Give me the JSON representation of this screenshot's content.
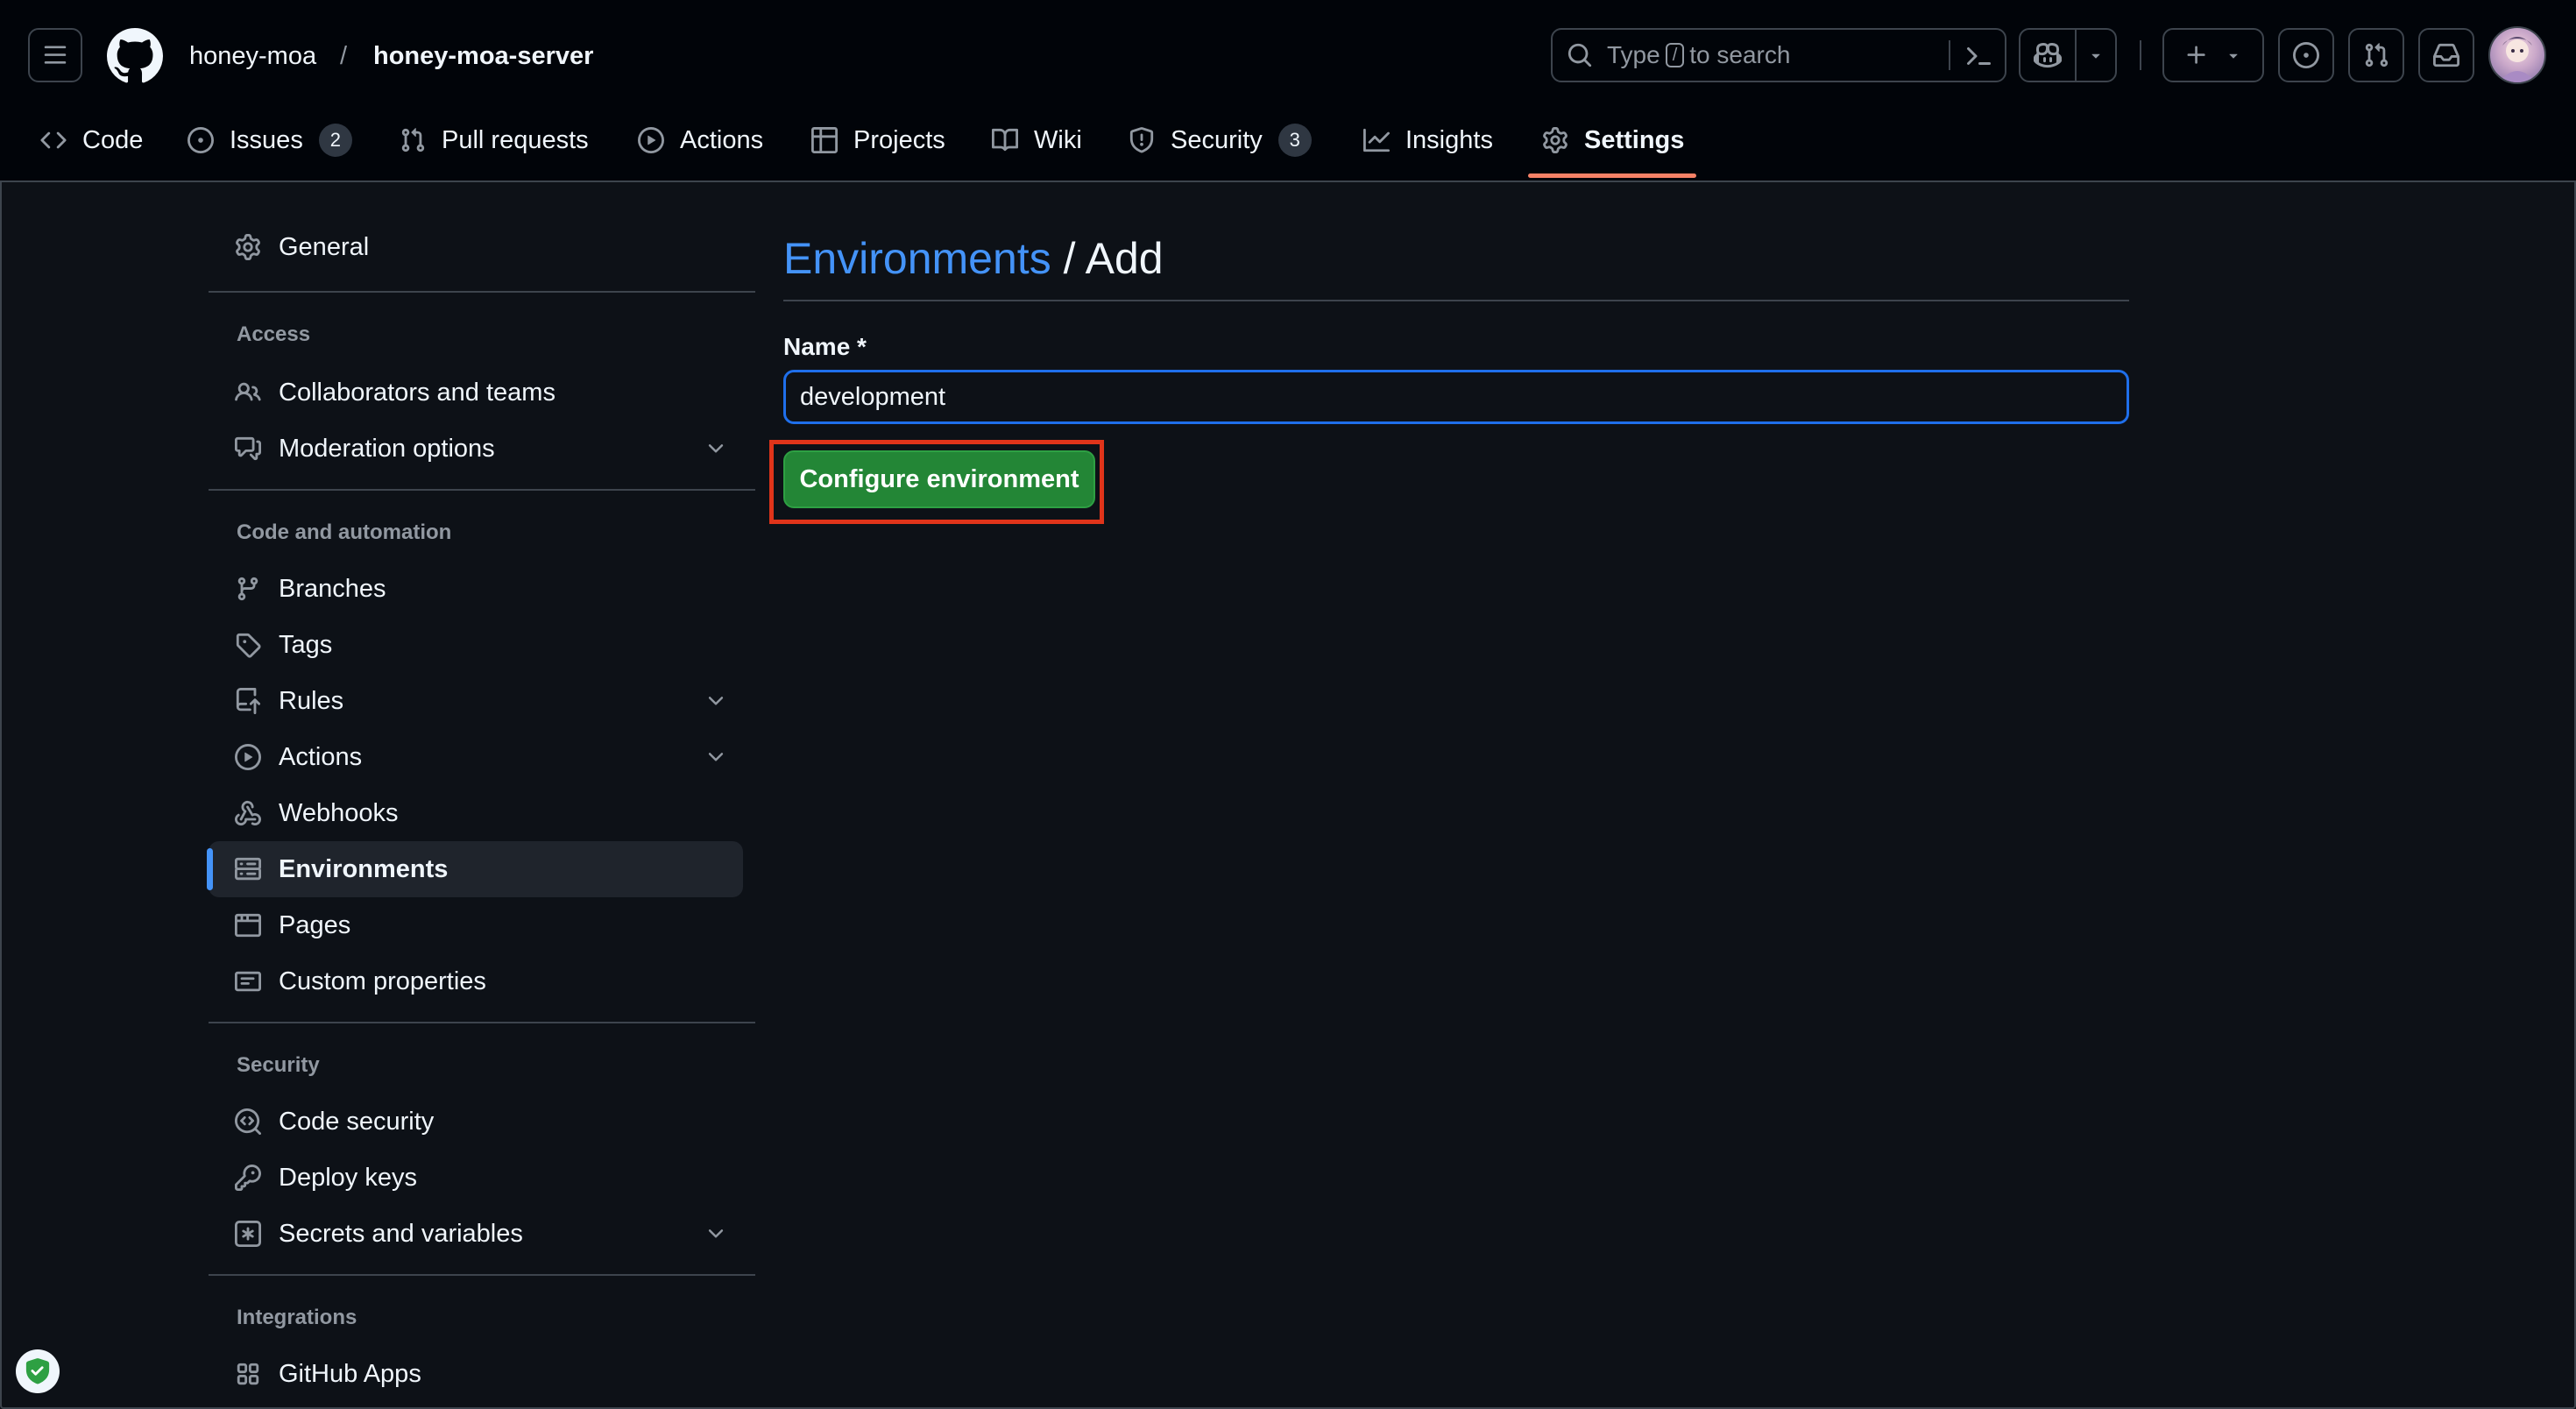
{
  "header": {
    "owner": "honey-moa",
    "separator": "/",
    "repo": "honey-moa-server",
    "search": {
      "prefix": "Type",
      "key": "/",
      "suffix": "to search"
    }
  },
  "tabs": [
    {
      "label": "Code",
      "icon": "code-icon"
    },
    {
      "label": "Issues",
      "icon": "issue-icon",
      "count": "2"
    },
    {
      "label": "Pull requests",
      "icon": "pull-request-icon"
    },
    {
      "label": "Actions",
      "icon": "play-icon"
    },
    {
      "label": "Projects",
      "icon": "table-icon"
    },
    {
      "label": "Wiki",
      "icon": "book-icon"
    },
    {
      "label": "Security",
      "icon": "shield-icon",
      "count": "3"
    },
    {
      "label": "Insights",
      "icon": "graph-icon"
    },
    {
      "label": "Settings",
      "icon": "gear-icon",
      "active": true
    }
  ],
  "sidebar": {
    "general": "General",
    "access": {
      "heading": "Access",
      "items": [
        "Collaborators and teams",
        "Moderation options"
      ]
    },
    "code_automation": {
      "heading": "Code and automation",
      "items": [
        "Branches",
        "Tags",
        "Rules",
        "Actions",
        "Webhooks",
        "Environments",
        "Pages",
        "Custom properties"
      ]
    },
    "security": {
      "heading": "Security",
      "items": [
        "Code security",
        "Deploy keys",
        "Secrets and variables"
      ]
    },
    "integrations": {
      "heading": "Integrations",
      "items": [
        "GitHub Apps"
      ]
    },
    "active_item": "Environments"
  },
  "main": {
    "breadcrumb_link": "Environments",
    "breadcrumb_rest": " / Add",
    "name_label": "Name *",
    "name_value": "development",
    "submit_label": "Configure environment"
  },
  "colors": {
    "background": "#0d1117",
    "header": "#010409",
    "accent_link": "#4493f8",
    "primary_button": "#238636",
    "tab_underline": "#f78166",
    "highlight_box": "#e0341a"
  }
}
